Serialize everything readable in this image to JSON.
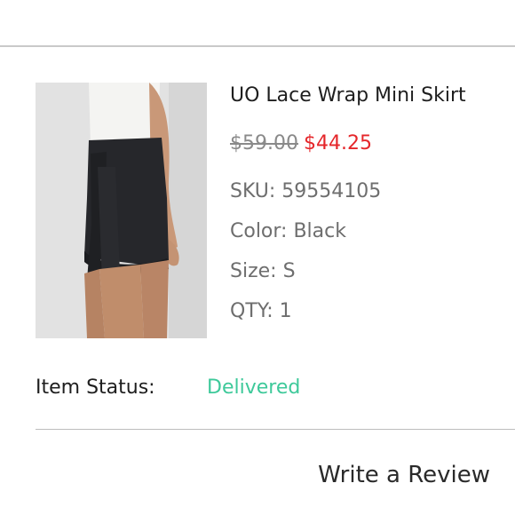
{
  "product": {
    "name": "UO Lace Wrap Mini Skirt",
    "original_price": "$59.00",
    "sale_price": "$44.25",
    "sku": "SKU: 59554105",
    "color": "Color: Black",
    "size": "Size: S",
    "qty": "QTY: 1"
  },
  "status": {
    "label": "Item Status:",
    "value": "Delivered"
  },
  "actions": {
    "review_label": "Write a Review"
  },
  "colors": {
    "sale_price": "#e5262a",
    "status_delivered": "#3ec99a"
  }
}
